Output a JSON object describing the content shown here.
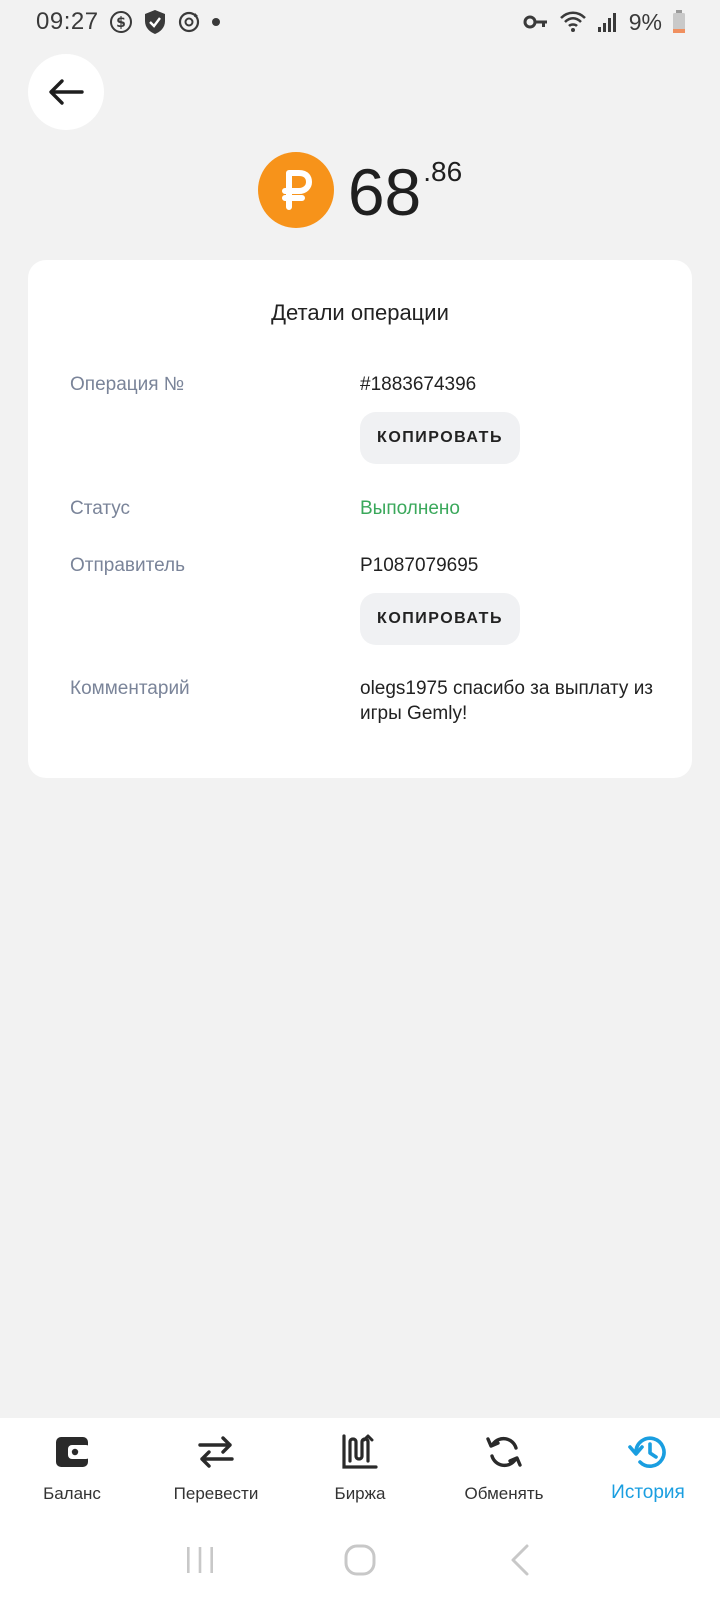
{
  "status_bar": {
    "time": "09:27",
    "battery": "9%",
    "icons": [
      "dollar-circle-icon",
      "shield-check-icon",
      "sync-icon",
      "dot-icon",
      "key-icon",
      "wifi-icon",
      "signal-icon",
      "battery-icon"
    ]
  },
  "header": {
    "back_icon": "arrow-left-icon",
    "amount_integer": "68",
    "amount_fraction": ".86",
    "currency_icon": "ruble-coin-icon",
    "currency_color": "#f7931a"
  },
  "details": {
    "title": "Детали операции",
    "operation_label": "Операция №",
    "operation_value": "#1883674396",
    "copy_label": "КОПИРОВАТЬ",
    "status_label": "Статус",
    "status_value": "Выполнено",
    "status_color": "#3aa85b",
    "sender_label": "Отправитель",
    "sender_value": "P1087079695",
    "comment_label": "Комментарий",
    "comment_value": "olegs1975 спасибо за выплату из игры Gemly!"
  },
  "bottom_nav": {
    "items": [
      {
        "label": "Баланс",
        "icon": "wallet-icon"
      },
      {
        "label": "Перевести",
        "icon": "transfer-arrows-icon"
      },
      {
        "label": "Биржа",
        "icon": "exchange-chart-icon"
      },
      {
        "label": "Обменять",
        "icon": "swap-circle-icon"
      },
      {
        "label": "История",
        "icon": "history-clock-icon"
      }
    ],
    "active_index": 4,
    "active_color": "#1a9ee0"
  },
  "system_nav": {
    "icons": [
      "recents-icon",
      "home-icon",
      "back-chevron-icon"
    ]
  }
}
